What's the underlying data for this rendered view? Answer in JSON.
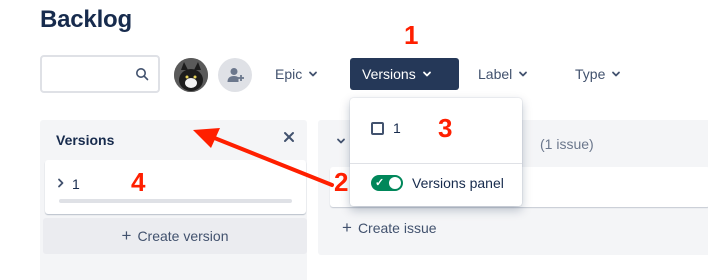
{
  "page": {
    "title": "Backlog"
  },
  "toolbar": {
    "search_placeholder": "",
    "filters": {
      "epic": "Epic",
      "versions": "Versions",
      "label": "Label",
      "type": "Type"
    }
  },
  "versions_panel": {
    "title": "Versions",
    "versions": [
      {
        "name": "1"
      }
    ],
    "create_label": "Create version"
  },
  "sprint": {
    "issue_count": "(1 issue)",
    "create_issue_label": "Create issue"
  },
  "versions_dropdown": {
    "options": [
      {
        "label": "1",
        "checked": false
      }
    ],
    "panel_toggle": {
      "label": "Versions panel",
      "on": true
    }
  },
  "annotations": {
    "n1": "1",
    "n2": "2",
    "n3": "3",
    "n4": "4",
    "color": "#ff1f00"
  },
  "colors": {
    "accent_dark": "#253858",
    "toggle_on": "#00875a",
    "panel_bg": "#f4f5f7"
  }
}
